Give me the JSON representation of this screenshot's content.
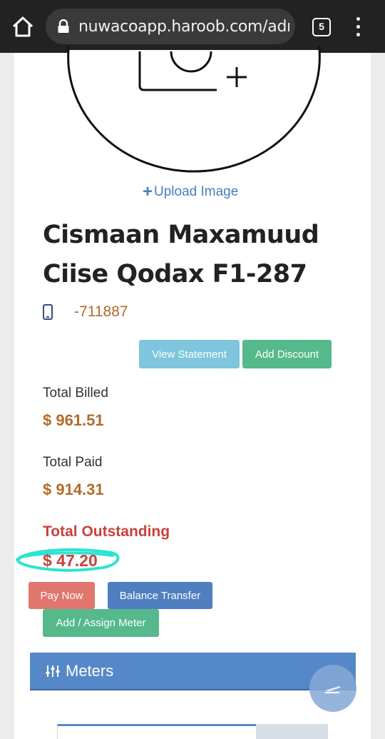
{
  "browser": {
    "url": "nuwacoapp.haroob.com/adn",
    "tab_count": "5"
  },
  "profile": {
    "upload_label": "Upload Image",
    "name": "Cismaan Maxamuud Ciise Qodax F1-287",
    "phone": "-711887"
  },
  "actions": {
    "view_statement": "View Statement",
    "add_discount": "Add Discount",
    "pay_now": "Pay Now",
    "balance_transfer": "Balance Transfer",
    "assign_meter": "Add / Assign Meter"
  },
  "totals": {
    "billed_label": "Total Billed",
    "billed_value": "$ 961.51",
    "paid_label": "Total Paid",
    "paid_value": "$ 914.31",
    "outstanding_label": "Total Outstanding",
    "outstanding_value": "$ 47.20"
  },
  "meters": {
    "title": "Meters"
  },
  "colors": {
    "accent_blue": "#5588c8",
    "amount_brown": "#b36b2a",
    "alert_red": "#c9413c",
    "success_green": "#55b98b",
    "info_cyan": "#7ec5dd",
    "highlight_cyan": "#2ee3d2"
  }
}
